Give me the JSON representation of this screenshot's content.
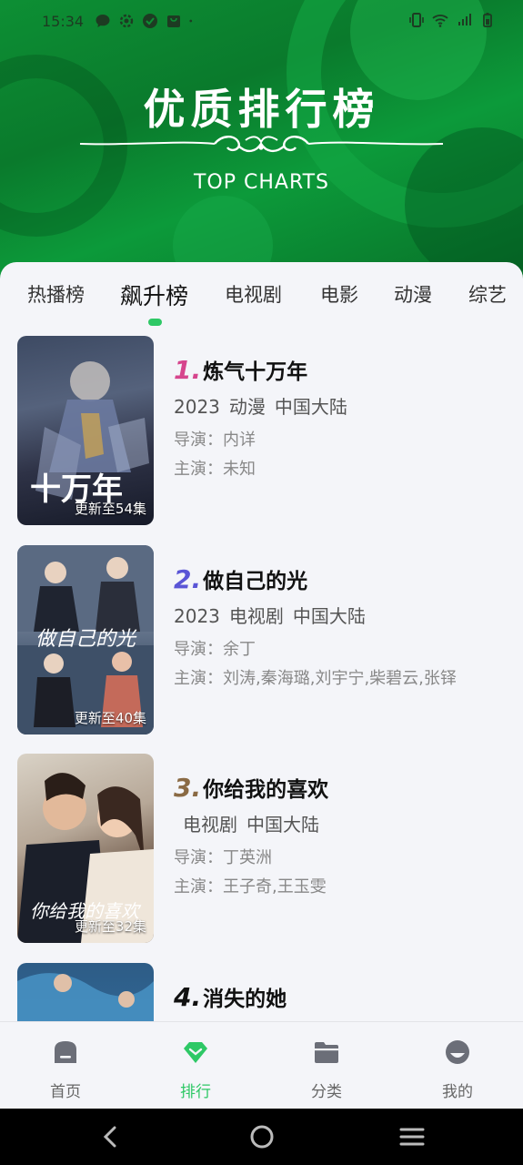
{
  "status_bar": {
    "time": "15:34"
  },
  "banner": {
    "title": "优质排行榜",
    "subtitle": "TOP CHARTS"
  },
  "tabs": [
    {
      "label": "热播榜",
      "active": false
    },
    {
      "label": "飙升榜",
      "active": true
    },
    {
      "label": "电视剧",
      "active": false
    },
    {
      "label": "电影",
      "active": false
    },
    {
      "label": "动漫",
      "active": false
    },
    {
      "label": "综艺",
      "active": false
    }
  ],
  "items": [
    {
      "rank": "1.",
      "rank_color": "#d6458d",
      "title": "炼气十万年",
      "year": "2023",
      "genre": "动漫",
      "region": "中国大陆",
      "director": "导演：内详",
      "actors": "主演：未知",
      "update": "更新至54集",
      "poster_overlay": "十万年"
    },
    {
      "rank": "2.",
      "rank_color": "#5a55d6",
      "title": "做自己的光",
      "year": "2023",
      "genre": "电视剧",
      "region": "中国大陆",
      "director": "导演：余丁",
      "actors": "主演：刘涛,秦海璐,刘宇宁,柴碧云,张铎",
      "update": "更新至40集",
      "poster_overlay": "做自己的光"
    },
    {
      "rank": "3.",
      "rank_color": "#8a6a44",
      "title": "你给我的喜欢",
      "year": "",
      "genre": "电视剧",
      "region": "中国大陆",
      "director": "导演：丁英洲",
      "actors": "主演：王子奇,王玉雯",
      "update": "更新至32集",
      "poster_overlay": "你给我的喜欢"
    },
    {
      "rank": "4.",
      "rank_color": "#111111",
      "title": "消失的她",
      "year": "",
      "genre": "",
      "region": "",
      "director": "",
      "actors": "",
      "update": "",
      "poster_overlay": ""
    }
  ],
  "bottom_nav": [
    {
      "label": "首页",
      "icon": "home-icon",
      "active": false
    },
    {
      "label": "排行",
      "icon": "diamond-icon",
      "active": true
    },
    {
      "label": "分类",
      "icon": "folder-icon",
      "active": false
    },
    {
      "label": "我的",
      "icon": "user-icon",
      "active": false
    }
  ],
  "colors": {
    "accent": "#2ec866",
    "banner_green": "#0a7a2c",
    "background": "#f4f5f9"
  }
}
